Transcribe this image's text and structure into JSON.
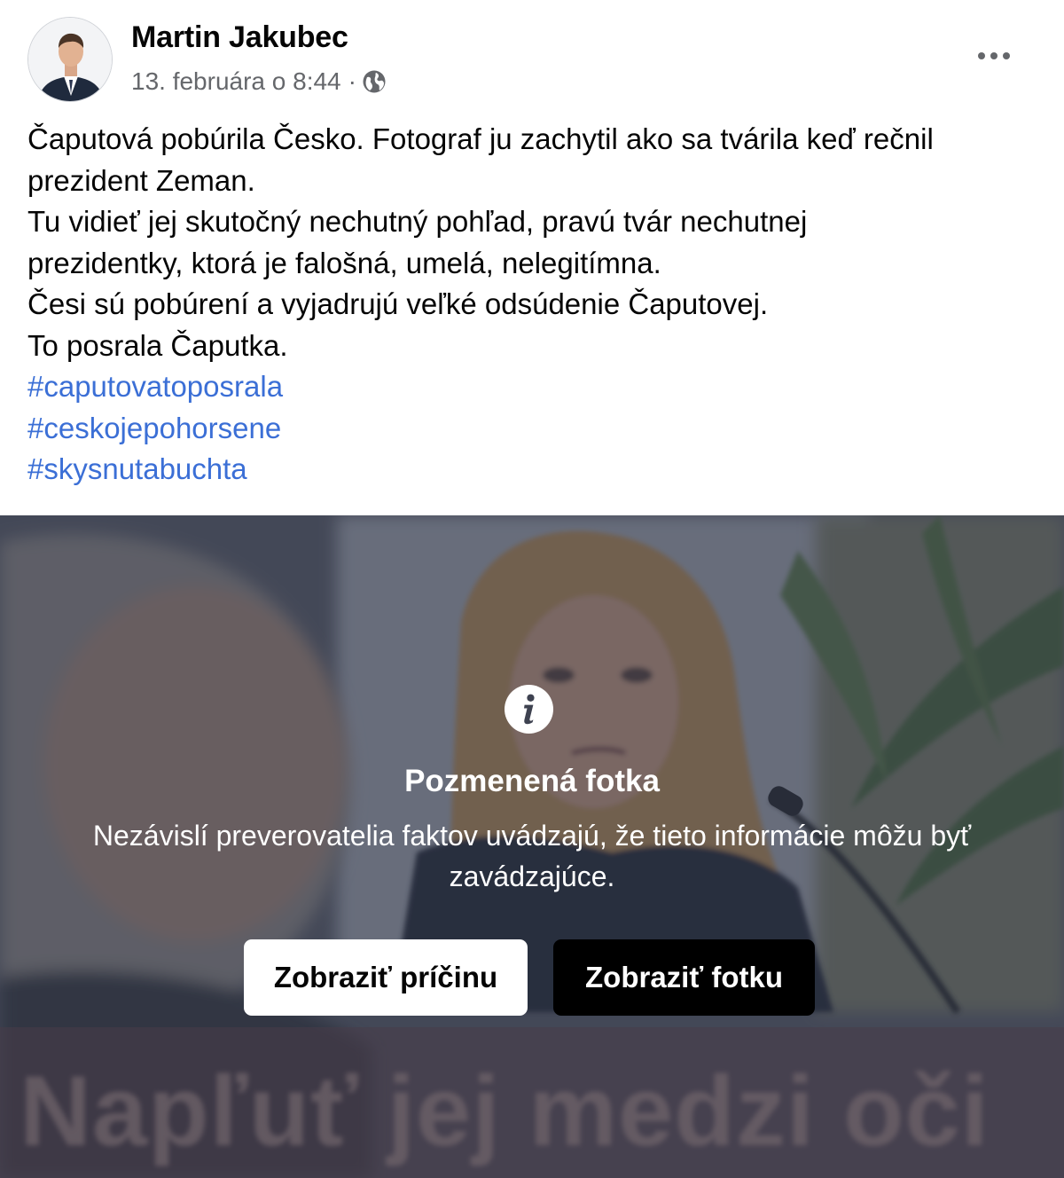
{
  "post": {
    "author": "Martin Jakubec",
    "timestamp": "13. februára o 8:44",
    "separator": "·",
    "privacy_icon": "globe-icon",
    "menu_icon": "more-horizontal-icon",
    "text_lines": [
      "Čaputová pobúrila Česko. Fotograf ju zachytil ako sa tvárila keď rečnil",
      "prezident Zeman.",
      "Tu vidieť jej skutočný nechutný pohľad, pravú tvár nechutnej",
      "prezidentky, ktorá je falošná, umelá, nelegitímna.",
      "Česi sú pobúrení a vyjadrujú veľké odsúdenie Čaputovej.",
      "To posrala Čaputka."
    ],
    "hashtags": [
      "#caputovatoposrala",
      "#ceskojepohorsene",
      "#skysnutabuchta"
    ]
  },
  "photo_overlay": {
    "icon": "info-icon",
    "title": "Pozmenená fotka",
    "description": "Nezávislí preverovatelia faktov uvádzajú, že tieto informácie môžu byť zavádzajúce.",
    "buttons": {
      "see_why": "Zobraziť príčinu",
      "see_photo": "Zobraziť fotku"
    },
    "blurred_caption": "Napľuť jej medzi oči"
  },
  "colors": {
    "text": "#050505",
    "secondary_text": "#65676b",
    "hashtag": "#3b6fd6",
    "overlay": "#3e4250"
  }
}
